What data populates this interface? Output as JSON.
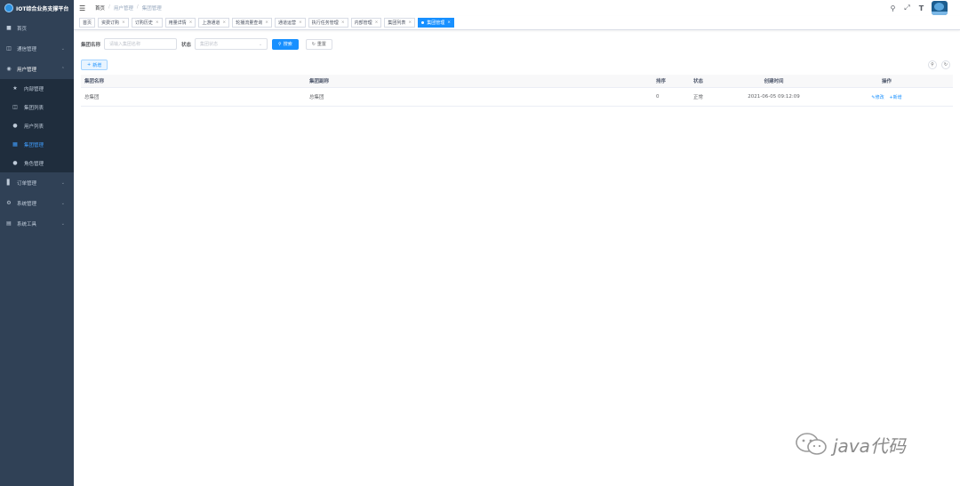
{
  "app": {
    "title": "IOT综合业务支撑平台"
  },
  "sidebar": {
    "items": [
      {
        "label": "首页",
        "icon": "dashboard-icon"
      },
      {
        "label": "通信管理",
        "icon": "communication-icon"
      },
      {
        "label": "用户管理",
        "icon": "user-group-icon",
        "open": true,
        "children": [
          {
            "label": "内部管理",
            "icon": "star-icon"
          },
          {
            "label": "集团列表",
            "icon": "group-list-icon"
          },
          {
            "label": "用户列表",
            "icon": "user-icon"
          },
          {
            "label": "集团管理",
            "icon": "tree-icon",
            "active": true
          },
          {
            "label": "角色管理",
            "icon": "role-icon"
          }
        ]
      },
      {
        "label": "订单管理",
        "icon": "chart-icon"
      },
      {
        "label": "系统管理",
        "icon": "gear-icon"
      },
      {
        "label": "系统工具",
        "icon": "tool-icon"
      }
    ]
  },
  "breadcrumb": [
    "首页",
    "用户管理",
    "集团管理"
  ],
  "tags": [
    {
      "label": "首页"
    },
    {
      "label": "资费订购"
    },
    {
      "label": "订购历史"
    },
    {
      "label": "用量详情"
    },
    {
      "label": "上游通道"
    },
    {
      "label": "轮播流量查询"
    },
    {
      "label": "通道运营"
    },
    {
      "label": "执行任务管理"
    },
    {
      "label": "内部管理"
    },
    {
      "label": "集团列表"
    },
    {
      "label": "集团管理",
      "active": true
    }
  ],
  "search": {
    "group_name_label": "集团名称",
    "group_name_placeholder": "请输入集团名称",
    "status_label": "状态",
    "status_placeholder": "集团状态",
    "search_button": "搜索",
    "reset_button": "重置"
  },
  "toolbar": {
    "add_button": "新增"
  },
  "table": {
    "columns": [
      "集团名称",
      "集团副称",
      "排序",
      "状态",
      "创建时间",
      "操作"
    ],
    "rows": [
      {
        "name": "总集团",
        "alias": "总集团",
        "sort": "0",
        "status": "正常",
        "created": "2021-06-05 09:12:09",
        "edit": "修改",
        "add": "新增"
      }
    ]
  },
  "watermark": {
    "text": "java代码"
  }
}
